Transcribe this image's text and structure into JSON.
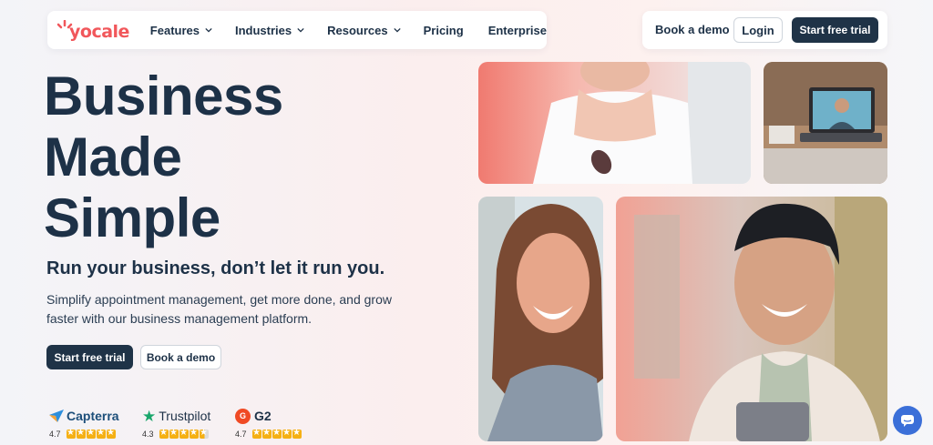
{
  "brand": {
    "name": "yocale",
    "color": "#f1575b"
  },
  "nav": {
    "items": [
      {
        "label": "Features",
        "dropdown": true
      },
      {
        "label": "Industries",
        "dropdown": true
      },
      {
        "label": "Resources",
        "dropdown": true
      },
      {
        "label": "Pricing",
        "dropdown": false
      },
      {
        "label": "Enterprise",
        "dropdown": false
      }
    ],
    "book_demo": "Book a demo",
    "login": "Login",
    "start_trial": "Start free trial"
  },
  "hero": {
    "title_lines": [
      "Business",
      "Made",
      "Simple"
    ],
    "subtitle": "Run your business, don’t let it run you.",
    "description": "Simplify appointment management, get more done, and grow faster with our business management platform.",
    "cta_primary": "Start free trial",
    "cta_secondary": "Book a demo"
  },
  "ratings": [
    {
      "brand": "Capterra",
      "score": "4.7",
      "icon": "capterra-icon",
      "stars": 5
    },
    {
      "brand": "Trustpilot",
      "score": "4.3",
      "icon": "trustpilot-star-icon",
      "stars": 4.5
    },
    {
      "brand": "G2",
      "score": "4.7",
      "icon": "g2-icon",
      "stars": 5
    }
  ],
  "colors": {
    "dark": "#1f3347",
    "accent": "#f1575b",
    "star": "#f5b014",
    "chat": "#3b6fd8"
  }
}
